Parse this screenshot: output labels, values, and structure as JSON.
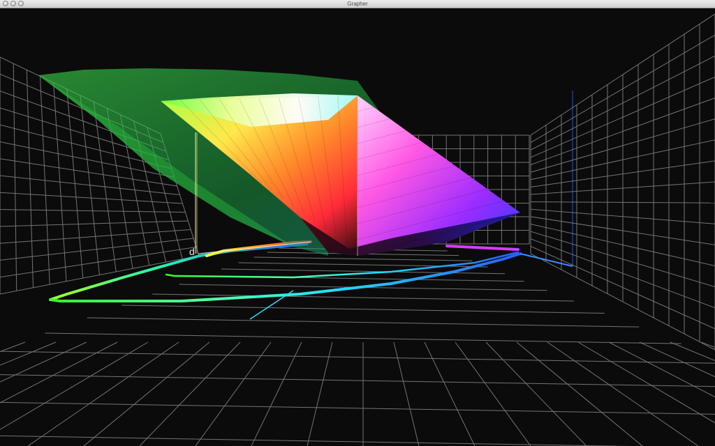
{
  "window": {
    "title": "Grapher"
  },
  "plot": {
    "axis_label": "d"
  },
  "colors": {
    "background": "#0b0b0b",
    "grid": "#9a9a9a",
    "outer_gamut": "#1f9a2e",
    "inner_gamut_top": "#ffffff",
    "axis_z": "#e8e8e8",
    "axis_y": "#3c8cff",
    "axis_x": "#2fd8ff"
  }
}
